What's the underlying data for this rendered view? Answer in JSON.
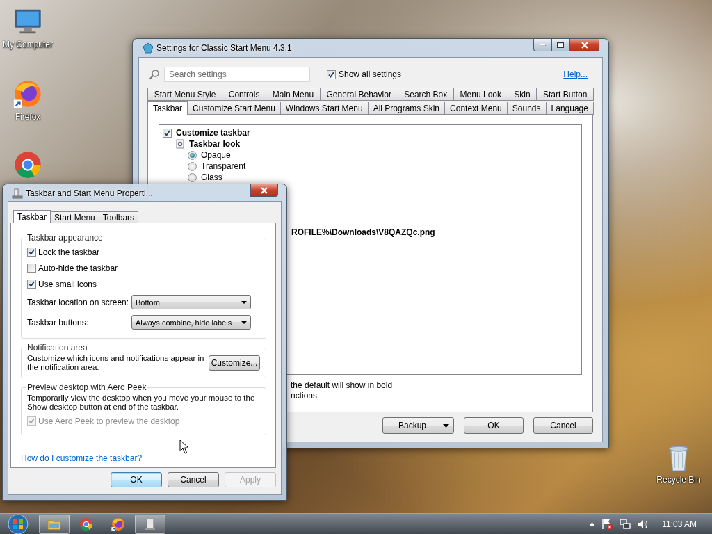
{
  "desktop_icons": [
    {
      "kind": "computer",
      "label": "My Computer"
    },
    {
      "kind": "firefox",
      "label": "Firefox"
    },
    {
      "kind": "chrome"
    },
    {
      "kind": "recycle",
      "label": "Recycle Bin"
    }
  ],
  "settings_window": {
    "title": "Settings for Classic Start Menu 4.3.1",
    "search": {
      "placeholder": "Search settings"
    },
    "show_all": {
      "label": "Show all settings",
      "checked": true
    },
    "help_link": "Help...",
    "tab_rows": [
      {
        "tabs": [
          {
            "label": "Start Menu Style",
            "selected": false
          },
          {
            "label": "Controls",
            "selected": false
          },
          {
            "label": "Main Menu",
            "selected": false
          },
          {
            "label": "General Behavior",
            "selected": false
          },
          {
            "label": "Search Box",
            "selected": false
          },
          {
            "label": "Menu Look",
            "selected": false
          },
          {
            "label": "Skin",
            "selected": false
          },
          {
            "label": "Start Button",
            "selected": false
          }
        ]
      },
      {
        "tabs": [
          {
            "label": "Taskbar",
            "selected": true
          },
          {
            "label": "Customize Start Menu",
            "selected": false
          },
          {
            "label": "Windows Start Menu",
            "selected": false
          },
          {
            "label": "All Programs Skin",
            "selected": false
          },
          {
            "label": "Context Menu",
            "selected": false
          },
          {
            "label": "Sounds",
            "selected": false
          },
          {
            "label": "Language",
            "selected": false
          }
        ]
      }
    ],
    "tree": [
      {
        "kind": "checkbox",
        "label": "Customize taskbar",
        "checked": true,
        "bold": true,
        "children": [
          {
            "kind": "group",
            "label": "Taskbar look",
            "bold": true,
            "children": [
              {
                "kind": "radio",
                "label": "Opaque",
                "selected": true,
                "bold": false
              },
              {
                "kind": "radio",
                "label": "Transparent",
                "selected": false,
                "bold": false
              },
              {
                "kind": "radio",
                "label": "Glass",
                "selected": false,
                "bold": false
              }
            ]
          }
        ]
      }
    ],
    "path_fragment": "ROFILE%\\Downloads\\V8QAZQc.png",
    "info_lines": [
      "the default will show in bold",
      "nctions"
    ],
    "buttons": [
      {
        "kind": "dropdown",
        "label": "Backup"
      },
      {
        "kind": "plain",
        "label": "OK"
      },
      {
        "kind": "plain",
        "label": "Cancel"
      }
    ]
  },
  "properties_dialog": {
    "title": "Taskbar and Start Menu Properti...",
    "tabs": [
      {
        "label": "Taskbar",
        "selected": true
      },
      {
        "label": "Start Menu",
        "selected": false
      },
      {
        "label": "Toolbars",
        "selected": false
      }
    ],
    "appearance": {
      "heading": "Taskbar appearance",
      "options": [
        {
          "label": "Lock the taskbar",
          "checked": true
        },
        {
          "label": "Auto-hide the taskbar",
          "checked": false
        },
        {
          "label": "Use small icons",
          "checked": true
        }
      ],
      "selects": [
        {
          "label": "Taskbar location on screen:",
          "value": "Bottom"
        },
        {
          "label": "Taskbar buttons:",
          "value": "Always combine, hide labels"
        }
      ]
    },
    "notification": {
      "heading": "Notification area",
      "text": "Customize which icons and notifications appear in the notification area.",
      "button": "Customize..."
    },
    "aero_peek": {
      "heading": "Preview desktop with Aero Peek",
      "text": "Temporarily view the desktop when you move your mouse to the Show desktop button at end of the taskbar.",
      "option": {
        "label": "Use Aero Peek to preview the desktop",
        "checked": true,
        "disabled": true
      }
    },
    "help_link": "How do I customize the taskbar?",
    "buttons": [
      {
        "label": "OK",
        "default": true,
        "disabled": false
      },
      {
        "label": "Cancel",
        "default": false,
        "disabled": false
      },
      {
        "label": "Apply",
        "default": false,
        "disabled": true
      }
    ]
  },
  "taskbar": {
    "apps": [
      {
        "kind": "explorer",
        "running": true
      },
      {
        "kind": "chrome",
        "running": false
      },
      {
        "kind": "firefox",
        "running": false
      },
      {
        "kind": "settings",
        "running": true
      }
    ],
    "clock": "11:03 AM"
  }
}
